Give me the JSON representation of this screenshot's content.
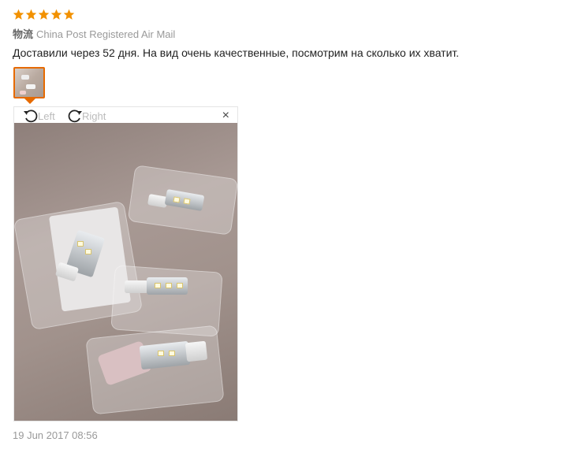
{
  "review": {
    "rating": 5,
    "rating_max": 5,
    "logistics_label": "物流",
    "logistics_value": "China Post Registered Air Mail",
    "text": "Доставили через 52 дня. На вид очень качественные, посмотрим на сколько их хватит.",
    "date": "19 Jun 2017 08:56"
  },
  "viewer": {
    "rotate_left_label": "Left",
    "rotate_right_label": "Right",
    "close_symbol": "×"
  },
  "colors": {
    "star": "#f29100",
    "accent": "#e66a00",
    "muted_text": "#999999"
  },
  "icons": {
    "star": "star-icon",
    "rotate_left": "rotate-left-icon",
    "rotate_right": "rotate-right-icon",
    "close": "close-icon"
  }
}
